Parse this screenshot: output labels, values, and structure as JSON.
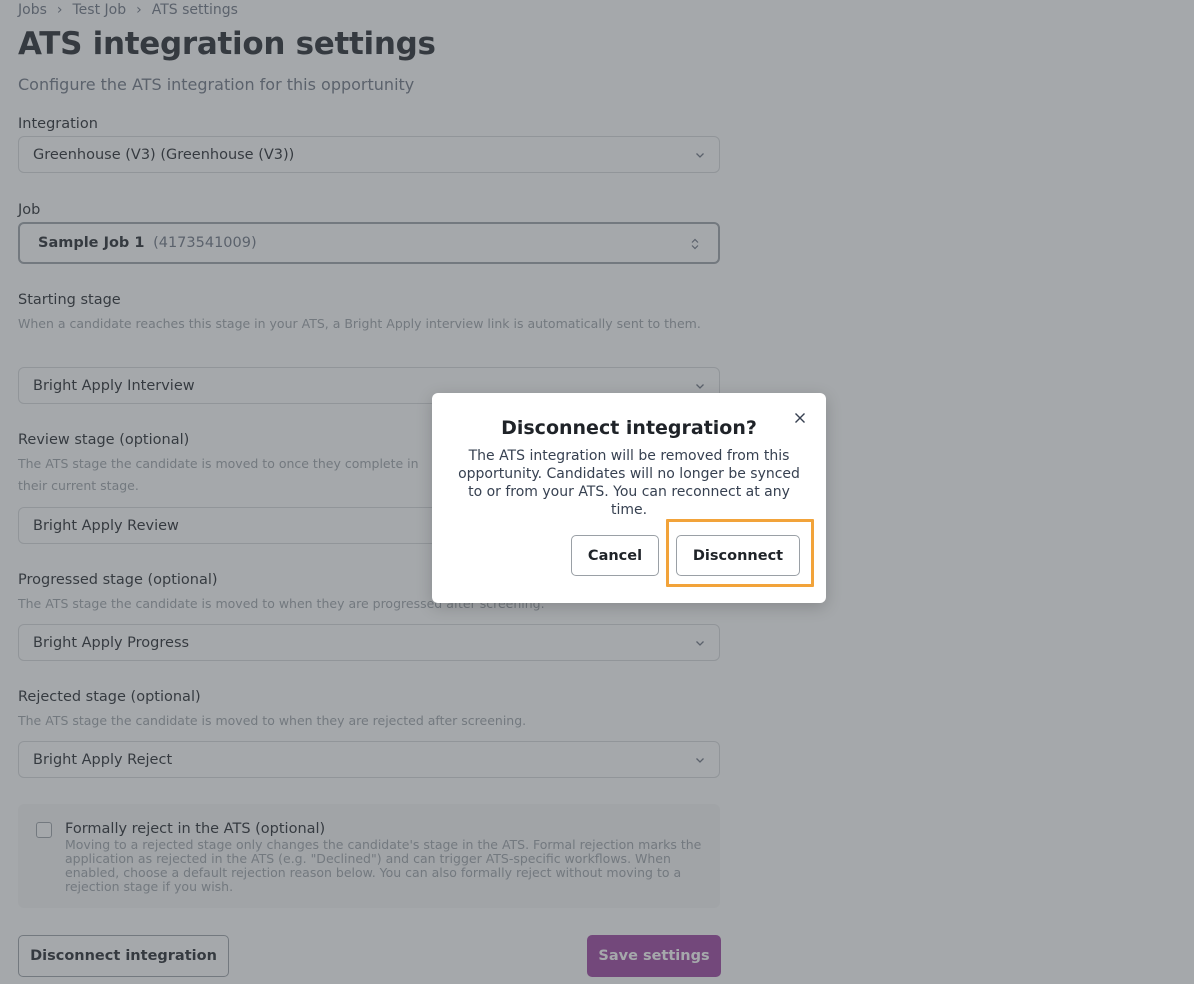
{
  "breadcrumb": {
    "items": [
      "Jobs",
      "Test Job",
      "ATS settings"
    ],
    "separator": "›"
  },
  "header": {
    "title": "ATS integration settings",
    "subtitle": "Configure the ATS integration for this opportunity"
  },
  "fields": {
    "integration": {
      "label": "Integration",
      "value": "Greenhouse (V3) (Greenhouse (V3))"
    },
    "job": {
      "label": "Job",
      "name": "Sample Job 1",
      "id": "(4173541009)"
    },
    "starting_stage": {
      "label": "Starting stage",
      "help": "When a candidate reaches this stage in your ATS, a Bright Apply interview link is automatically sent to them.",
      "value": "Bright Apply Interview"
    },
    "review_stage": {
      "label": "Review stage (optional)",
      "help": "The ATS stage the candidate is moved to once they complete in their current stage.",
      "value": "Bright Apply Review"
    },
    "progressed_stage": {
      "label": "Progressed stage (optional)",
      "help": "The ATS stage the candidate is moved to when they are progressed after screening.",
      "value": "Bright Apply Progress"
    },
    "rejected_stage": {
      "label": "Rejected stage (optional)",
      "help": "The ATS stage the candidate is moved to when they are rejected after screening.",
      "value": "Bright Apply Reject"
    }
  },
  "formal_reject": {
    "label": "Formally reject in the ATS (optional)",
    "description": "Moving to a rejected stage only changes the candidate's stage in the ATS. Formal rejection marks the application as rejected in the ATS (e.g. \"Declined\") and can trigger ATS-specific workflows. When enabled, choose a default rejection reason below. You can also formally reject without moving to a rejection stage if you wish.",
    "checked": false
  },
  "actions": {
    "disconnect_label": "Disconnect integration",
    "save_label": "Save settings"
  },
  "modal": {
    "title": "Disconnect integration?",
    "body": "The ATS integration will be removed from this opportunity. Candidates will no longer be synced to or from your ATS. You can reconnect at any time.",
    "cancel_label": "Cancel",
    "confirm_label": "Disconnect"
  },
  "colors": {
    "primary": "#9a3f9e",
    "highlight": "#f2a33a",
    "overlay": "rgba(75, 82, 88, 0.5)"
  },
  "icons": {
    "select": "chevron-down-icon",
    "job_select": "chevron-up-down-icon",
    "close": "close-icon"
  }
}
